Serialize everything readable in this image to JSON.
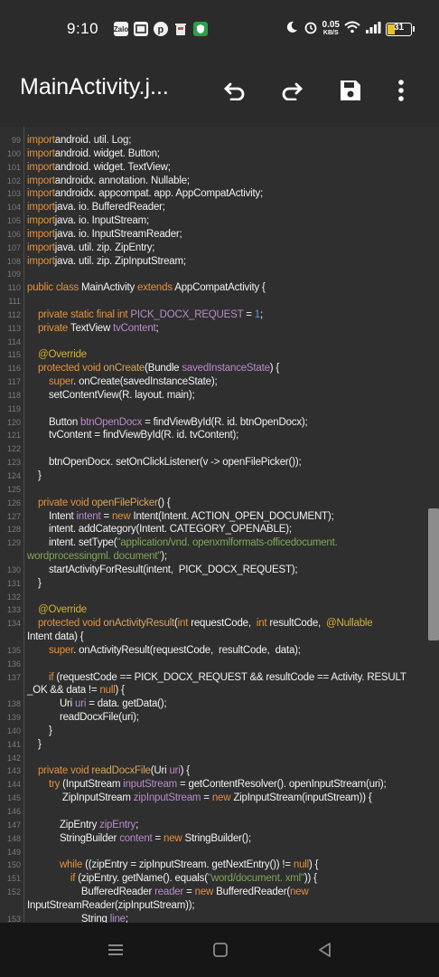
{
  "status_bar": {
    "time": "9:10",
    "notif_icons": [
      "zalo-icon",
      "mi-icon",
      "pinterest-icon",
      "trash-icon",
      "shield-icon"
    ],
    "zalo_label": "Zalo",
    "net_speed": "0.05",
    "net_unit": "KB/S",
    "battery": "31",
    "battery_level": 0.31
  },
  "app_bar": {
    "title": "MainActivity.j...",
    "icons": [
      "undo-icon",
      "redo-icon",
      "save-icon",
      "more-vert-icon"
    ]
  },
  "code": {
    "lines": [
      {
        "n": "99",
        "t": [
          [
            "kw",
            "import"
          ],
          [
            "",
            "android. util. Log;"
          ]
        ]
      },
      {
        "n": "100",
        "t": [
          [
            "kw",
            "import"
          ],
          [
            "",
            "android. widget. Button;"
          ]
        ]
      },
      {
        "n": "101",
        "t": [
          [
            "kw",
            "import"
          ],
          [
            "",
            "android. widget. TextView;"
          ]
        ]
      },
      {
        "n": "102",
        "t": [
          [
            "kw",
            "import"
          ],
          [
            "",
            "androidx. annotation. Nullable;"
          ]
        ]
      },
      {
        "n": "103",
        "t": [
          [
            "kw",
            "import"
          ],
          [
            "",
            "androidx. appcompat. app. AppCompatActivity;"
          ]
        ]
      },
      {
        "n": "104",
        "t": [
          [
            "kw",
            "import"
          ],
          [
            "",
            "java. io. BufferedReader;"
          ]
        ]
      },
      {
        "n": "105",
        "t": [
          [
            "kw",
            "import"
          ],
          [
            "",
            "java. io. InputStream;"
          ]
        ]
      },
      {
        "n": "106",
        "t": [
          [
            "kw",
            "import"
          ],
          [
            "",
            "java. io. InputStreamReader;"
          ]
        ]
      },
      {
        "n": "107",
        "t": [
          [
            "kw",
            "import"
          ],
          [
            "",
            "java. util. zip. ZipEntry;"
          ]
        ]
      },
      {
        "n": "108",
        "t": [
          [
            "kw",
            "import"
          ],
          [
            "",
            "java. util. zip. ZipInputStream;"
          ]
        ]
      },
      {
        "n": "109",
        "t": []
      },
      {
        "n": "110",
        "t": [
          [
            "kw",
            "public class "
          ],
          [
            "",
            "MainActivity "
          ],
          [
            "kw",
            "extends "
          ],
          [
            "",
            "AppCompatActivity {"
          ]
        ]
      },
      {
        "n": "111",
        "t": []
      },
      {
        "n": "112",
        "t": [
          [
            "",
            "    "
          ],
          [
            "kw",
            "private static final int "
          ],
          [
            "vr",
            "PICK_DOCX_REQUEST"
          ],
          [
            "",
            " = "
          ],
          [
            "nm",
            "1"
          ],
          [
            "",
            ";"
          ]
        ]
      },
      {
        "n": "113",
        "t": [
          [
            "",
            "    "
          ],
          [
            "kw",
            "private "
          ],
          [
            "",
            "TextView "
          ],
          [
            "vr",
            "tvContent"
          ],
          [
            "",
            ";"
          ]
        ]
      },
      {
        "n": "114",
        "t": []
      },
      {
        "n": "115",
        "t": [
          [
            "",
            "    "
          ],
          [
            "an",
            "@Override"
          ]
        ]
      },
      {
        "n": "116",
        "t": [
          [
            "",
            "    "
          ],
          [
            "kw",
            "protected void "
          ],
          [
            "fn",
            "onCreate"
          ],
          [
            "",
            "(Bundle "
          ],
          [
            "vr",
            "savedInstanceState"
          ],
          [
            "",
            ") {"
          ]
        ]
      },
      {
        "n": "117",
        "t": [
          [
            "",
            "        "
          ],
          [
            "kw",
            "super"
          ],
          [
            "",
            ". onCreate(savedInstanceState);"
          ]
        ]
      },
      {
        "n": "118",
        "t": [
          [
            "",
            "        setContentView(R. layout. main);"
          ]
        ]
      },
      {
        "n": "119",
        "t": []
      },
      {
        "n": "120",
        "t": [
          [
            "",
            "        Button "
          ],
          [
            "vr",
            "btnOpenDocx"
          ],
          [
            "",
            " = findViewById(R. id. btnOpenDocx);"
          ]
        ]
      },
      {
        "n": "121",
        "t": [
          [
            "",
            "        tvContent = findViewById(R. id. tvContent);"
          ]
        ]
      },
      {
        "n": "122",
        "t": []
      },
      {
        "n": "123",
        "t": [
          [
            "",
            "        btnOpenDocx. setOnClickListener(v -> openFilePicker());"
          ]
        ]
      },
      {
        "n": "124",
        "t": [
          [
            "",
            "    }"
          ]
        ]
      },
      {
        "n": "125",
        "t": []
      },
      {
        "n": "126",
        "t": [
          [
            "",
            "    "
          ],
          [
            "kw",
            "private void "
          ],
          [
            "fn",
            "openFilePicker"
          ],
          [
            "",
            "() {"
          ]
        ]
      },
      {
        "n": "127",
        "t": [
          [
            "",
            "        Intent "
          ],
          [
            "vr",
            "intent"
          ],
          [
            "",
            " = "
          ],
          [
            "kw",
            "new "
          ],
          [
            "",
            "Intent(Intent. ACTION_OPEN_DOCUMENT);"
          ]
        ]
      },
      {
        "n": "128",
        "t": [
          [
            "",
            "        intent. addCategory(Intent. CATEGORY_OPENABLE);"
          ]
        ]
      },
      {
        "n": "129",
        "t": [
          [
            "",
            "        intent. setType("
          ],
          [
            "st",
            "\"application/vnd. openxmlformats-officedocument."
          ]
        ]
      },
      {
        "n": "",
        "t": [
          [
            "st",
            "wordprocessingml. document\""
          ],
          [
            "",
            ");"
          ]
        ]
      },
      {
        "n": "130",
        "t": [
          [
            "",
            "        startActivityForResult(intent,  PICK_DOCX_REQUEST);"
          ]
        ]
      },
      {
        "n": "131",
        "t": [
          [
            "",
            "    }"
          ]
        ]
      },
      {
        "n": "132",
        "t": []
      },
      {
        "n": "133",
        "t": [
          [
            "",
            "    "
          ],
          [
            "an",
            "@Override"
          ]
        ]
      },
      {
        "n": "134",
        "t": [
          [
            "",
            "    "
          ],
          [
            "kw",
            "protected void "
          ],
          [
            "fn",
            "onActivityResult"
          ],
          [
            "",
            "("
          ],
          [
            "kw",
            "int "
          ],
          [
            "",
            "requestCode,  "
          ],
          [
            "kw",
            "int "
          ],
          [
            "",
            "resultCode,  "
          ],
          [
            "an",
            "@Nullable"
          ]
        ]
      },
      {
        "n": "",
        "t": [
          [
            "",
            "Intent data) {"
          ]
        ]
      },
      {
        "n": "135",
        "t": [
          [
            "",
            "        "
          ],
          [
            "kw",
            "super"
          ],
          [
            "",
            ". onActivityResult(requestCode,  resultCode,  data);"
          ]
        ]
      },
      {
        "n": "136",
        "t": []
      },
      {
        "n": "137",
        "t": [
          [
            "",
            "        "
          ],
          [
            "kw",
            "if "
          ],
          [
            "",
            "(requestCode == PICK_DOCX_REQUEST && resultCode == Activity. RESULT"
          ]
        ]
      },
      {
        "n": "",
        "t": [
          [
            "",
            "_OK && data != "
          ],
          [
            "kw",
            "null"
          ],
          [
            "",
            ") {"
          ]
        ]
      },
      {
        "n": "138",
        "t": [
          [
            "",
            "            Uri "
          ],
          [
            "vr",
            "uri"
          ],
          [
            "",
            " = data. getData();"
          ]
        ]
      },
      {
        "n": "139",
        "t": [
          [
            "",
            "            readDocxFile(uri);"
          ]
        ]
      },
      {
        "n": "140",
        "t": [
          [
            "",
            "        }"
          ]
        ]
      },
      {
        "n": "141",
        "t": [
          [
            "",
            "    }"
          ]
        ]
      },
      {
        "n": "142",
        "t": []
      },
      {
        "n": "143",
        "t": [
          [
            "",
            "    "
          ],
          [
            "kw",
            "private void "
          ],
          [
            "fn",
            "readDocxFile"
          ],
          [
            "",
            "(Uri "
          ],
          [
            "vr",
            "uri"
          ],
          [
            "",
            ") {"
          ]
        ]
      },
      {
        "n": "144",
        "t": [
          [
            "",
            "        "
          ],
          [
            "kw",
            "try "
          ],
          [
            "",
            "(InputStream "
          ],
          [
            "vr",
            "inputStream"
          ],
          [
            "",
            " = getContentResolver(). openInputStream(uri);"
          ]
        ]
      },
      {
        "n": "145",
        "t": [
          [
            "",
            "             ZipInputStream "
          ],
          [
            "vr",
            "zipInputStream"
          ],
          [
            "",
            " = "
          ],
          [
            "kw",
            "new "
          ],
          [
            "",
            "ZipInputStream(inputStream)) {"
          ]
        ]
      },
      {
        "n": "146",
        "t": []
      },
      {
        "n": "147",
        "t": [
          [
            "",
            "            ZipEntry "
          ],
          [
            "vr",
            "zipEntry"
          ],
          [
            "",
            ";"
          ]
        ]
      },
      {
        "n": "148",
        "t": [
          [
            "",
            "            StringBuilder "
          ],
          [
            "vr",
            "content"
          ],
          [
            "",
            " = "
          ],
          [
            "kw",
            "new "
          ],
          [
            "",
            "StringBuilder();"
          ]
        ]
      },
      {
        "n": "149",
        "t": []
      },
      {
        "n": "150",
        "t": [
          [
            "",
            "            "
          ],
          [
            "kw",
            "while "
          ],
          [
            "",
            "((zipEntry = zipInputStream. getNextEntry()) != "
          ],
          [
            "kw",
            "null"
          ],
          [
            "",
            ") {"
          ]
        ]
      },
      {
        "n": "151",
        "t": [
          [
            "",
            "                "
          ],
          [
            "kw",
            "if "
          ],
          [
            "",
            "(zipEntry. getName(). equals("
          ],
          [
            "st",
            "\"word/document. xml\""
          ],
          [
            "",
            ")) {"
          ]
        ]
      },
      {
        "n": "152",
        "t": [
          [
            "",
            "                    BufferedReader "
          ],
          [
            "vr",
            "reader"
          ],
          [
            "",
            " = "
          ],
          [
            "kw",
            "new "
          ],
          [
            "",
            "BufferedReader("
          ],
          [
            "kw",
            "new"
          ]
        ]
      },
      {
        "n": "",
        "t": [
          [
            "",
            "InputStreamReader(zipInputStream));"
          ]
        ]
      },
      {
        "n": "153",
        "t": [
          [
            "",
            "                    String "
          ],
          [
            "vr",
            "line"
          ],
          [
            "",
            ";"
          ]
        ]
      }
    ]
  },
  "nav_bar": {
    "icons": [
      "recents-icon",
      "home-icon",
      "back-icon"
    ]
  },
  "colors": {
    "background": "#2f2f2f",
    "keyword": "#e2923e",
    "variable": "#b98bc9",
    "annotation": "#d4b232",
    "string": "#7fa75a",
    "number": "#5a96d8"
  }
}
